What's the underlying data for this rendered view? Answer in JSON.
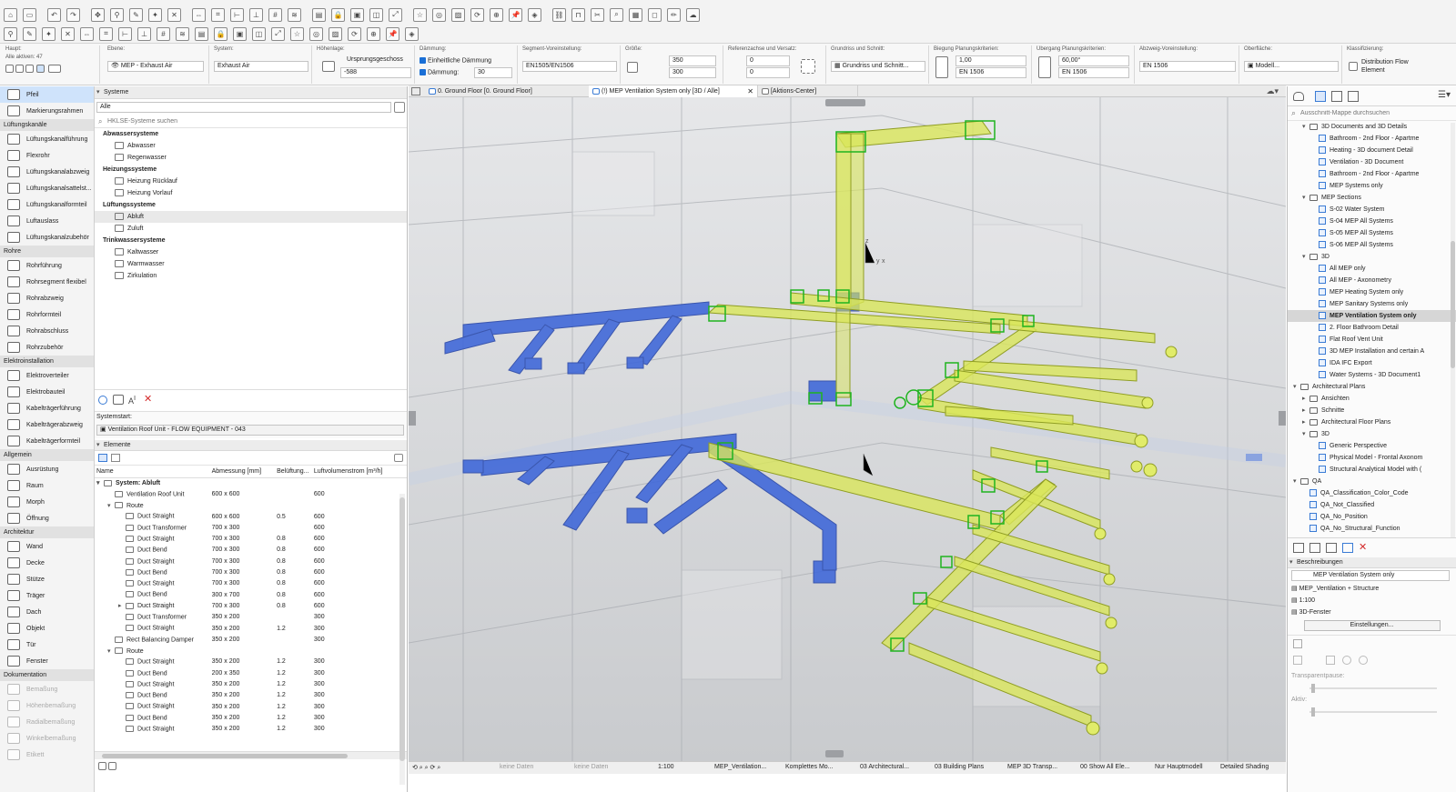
{
  "toolbar": {
    "row1_icons": [
      "home-icon",
      "save-icon",
      "undo-icon",
      "redo-icon",
      "pick-icon",
      "eyedropper-icon",
      "inject-icon",
      "magic-wand-icon",
      "cross-icon",
      "drag-icon",
      "snap-icon",
      "guide-icon",
      "gravity-icon",
      "grid-icon",
      "trace-icon",
      "layer-icon",
      "lock-icon",
      "group-icon",
      "suspend-icon",
      "transform-icon",
      "favorites-icon",
      "renovation-icon",
      "image-icon",
      "rotate-icon",
      "zoom-icon",
      "pin-icon",
      "fill-icon",
      "link-icon",
      "fence-icon",
      "cut-icon",
      "search-icon",
      "table-icon",
      "cube-icon",
      "brush-icon",
      "cloud-icon"
    ],
    "row2_icons": [
      "select-icon",
      "fill-pick-icon",
      "percent-icon",
      "layers-icon",
      "trace1-icon",
      "trace2-icon",
      "trace3-icon",
      "render-icon",
      "zoom-in-icon",
      "zoom-out-icon",
      "teamwork-icon",
      "orbit-icon",
      "view-icon",
      "camera-icon",
      "walk-icon",
      "window-icon",
      "grid2-icon",
      "sun-icon",
      "shadow-icon",
      "align-icon",
      "measure-icon",
      "marker-icon"
    ]
  },
  "infobox": {
    "haupt_label": "Haupt:",
    "alle_aktiv": "Alle aktiven: 47",
    "ebene_label": "Ebene:",
    "ebene_value": "MEP - Exhaust Air",
    "system_label": "System:",
    "system_value": "Exhaust Air",
    "hoehenlage_label": "Höhenlage:",
    "hoehenlage_value": "Ursprungsgeschoss",
    "hoehenlage_num": "-588",
    "daemmung_label": "Dämmung:",
    "einheitliche": "Einheitliche Dämmung",
    "daemmung_field": "Dämmung:",
    "daemmung_value": "30",
    "segment_label": "Segment-Voreinstellung:",
    "segment_value": "EN1505/EN1506",
    "groesse_label": "Größe:",
    "groesse_w": "350",
    "groesse_h": "300",
    "referenz_label": "Referenzachse und Versatz:",
    "ref_x": "0",
    "ref_y": "0",
    "grundriss_label": "Grundriss und Schnitt:",
    "grundriss_value": "Grundriss und Schnitt...",
    "biegung_label": "Biegung Planungskriterien:",
    "biegung_value": "1,00",
    "biegung_norm": "EN 1506",
    "uebergang_label": "Übergang Planungskriterien:",
    "uebergang_value": "60,00°",
    "uebergang_norm": "EN 1506",
    "abzweig_label": "Abzweig-Voreinstellung:",
    "abzweig_value": "EN 1506",
    "oberflaeche_label": "Oberfläche:",
    "oberflaeche_value": "Modell...",
    "klassifizierung_label": "Klassifizierung:",
    "klassifizierung_value1": "Distribution Flow",
    "klassifizierung_value2": "Element"
  },
  "toolbox": {
    "items": [
      {
        "type": "tool",
        "label": "Pfeil",
        "selected": true,
        "icon": "arrow-icon"
      },
      {
        "type": "tool",
        "label": "Markierungsrahmen",
        "icon": "marquee-icon"
      },
      {
        "type": "group",
        "label": "Lüftungskanäle"
      },
      {
        "type": "tool",
        "label": "Lüftungskanalführung",
        "icon": "duct-routing-icon"
      },
      {
        "type": "tool",
        "label": "Flexrohr",
        "icon": "flex-duct-icon"
      },
      {
        "type": "tool",
        "label": "Lüftungskanalabzweig",
        "icon": "duct-branch-icon"
      },
      {
        "type": "tool",
        "label": "Lüftungskanalsattelst...",
        "icon": "duct-saddle-icon"
      },
      {
        "type": "tool",
        "label": "Lüftungskanalformteil",
        "icon": "duct-fitting-icon"
      },
      {
        "type": "tool",
        "label": "Luftauslass",
        "icon": "air-terminal-icon"
      },
      {
        "type": "tool",
        "label": "Lüftungskanalzubehör",
        "icon": "duct-accessory-icon"
      },
      {
        "type": "group",
        "label": "Rohre"
      },
      {
        "type": "tool",
        "label": "Rohrführung",
        "icon": "pipe-routing-icon"
      },
      {
        "type": "tool",
        "label": "Rohrsegment flexibel",
        "icon": "flex-pipe-icon"
      },
      {
        "type": "tool",
        "label": "Rohrabzweig",
        "icon": "pipe-branch-icon"
      },
      {
        "type": "tool",
        "label": "Rohrformteil",
        "icon": "pipe-fitting-icon"
      },
      {
        "type": "tool",
        "label": "Rohrabschluss",
        "icon": "pipe-end-icon"
      },
      {
        "type": "tool",
        "label": "Rohrzubehör",
        "icon": "pipe-accessory-icon"
      },
      {
        "type": "group",
        "label": "Elektroinstallation"
      },
      {
        "type": "tool",
        "label": "Elektroverteiler",
        "icon": "electrical-panel-icon"
      },
      {
        "type": "tool",
        "label": "Elektrobauteil",
        "icon": "electrical-part-icon"
      },
      {
        "type": "tool",
        "label": "Kabelträgerführung",
        "icon": "cable-tray-icon"
      },
      {
        "type": "tool",
        "label": "Kabelträgerabzweig",
        "icon": "cable-branch-icon"
      },
      {
        "type": "tool",
        "label": "Kabelträgerformteil",
        "icon": "cable-fitting-icon"
      },
      {
        "type": "group",
        "label": "Allgemein"
      },
      {
        "type": "tool",
        "label": "Ausrüstung",
        "icon": "equipment-icon"
      },
      {
        "type": "tool",
        "label": "Raum",
        "icon": "zone-icon"
      },
      {
        "type": "tool",
        "label": "Morph",
        "icon": "morph-icon"
      },
      {
        "type": "tool",
        "label": "Öffnung",
        "icon": "opening-icon"
      },
      {
        "type": "group",
        "label": "Architektur"
      },
      {
        "type": "tool",
        "label": "Wand",
        "icon": "wall-icon"
      },
      {
        "type": "tool",
        "label": "Decke",
        "icon": "slab-icon"
      },
      {
        "type": "tool",
        "label": "Stütze",
        "icon": "column-icon"
      },
      {
        "type": "tool",
        "label": "Träger",
        "icon": "beam-icon"
      },
      {
        "type": "tool",
        "label": "Dach",
        "icon": "roof-icon"
      },
      {
        "type": "tool",
        "label": "Objekt",
        "icon": "object-icon"
      },
      {
        "type": "tool",
        "label": "Tür",
        "icon": "door-icon"
      },
      {
        "type": "tool",
        "label": "Fenster",
        "icon": "window-icon"
      },
      {
        "type": "group",
        "label": "Dokumentation"
      },
      {
        "type": "tool",
        "label": "Bemaßung",
        "dim": true,
        "icon": "dimension-icon"
      },
      {
        "type": "tool",
        "label": "Höhenbemaßung",
        "dim": true,
        "icon": "level-dimension-icon"
      },
      {
        "type": "tool",
        "label": "Radialbemaßung",
        "dim": true,
        "icon": "radial-dimension-icon"
      },
      {
        "type": "tool",
        "label": "Winkelbemaßung",
        "dim": true,
        "icon": "angle-dimension-icon"
      },
      {
        "type": "tool",
        "label": "Etikett",
        "dim": true,
        "icon": "label-icon"
      }
    ]
  },
  "navigator": {
    "header": "Systeme",
    "filter_value": "Alle",
    "search_placeholder": "HKLSE-Systeme suchen",
    "tree": [
      {
        "type": "b",
        "label": "Abwassersysteme"
      },
      {
        "type": "c",
        "label": "Abwasser"
      },
      {
        "type": "c",
        "label": "Regenwasser"
      },
      {
        "type": "b",
        "label": "Heizungssysteme"
      },
      {
        "type": "c",
        "label": "Heizung Rücklauf"
      },
      {
        "type": "c",
        "label": "Heizung Vorlauf"
      },
      {
        "type": "b",
        "label": "Lüftungssysteme"
      },
      {
        "type": "c",
        "label": "Abluft",
        "hl": true
      },
      {
        "type": "c",
        "label": "Zuluft"
      },
      {
        "type": "b",
        "label": "Trinkwassersysteme"
      },
      {
        "type": "c",
        "label": "Kaltwasser"
      },
      {
        "type": "c",
        "label": "Warmwasser"
      },
      {
        "type": "c",
        "label": "Zirkulation"
      }
    ],
    "systemstart_label": "Systemstart:",
    "systemstart_value": "Ventilation Roof Unit - FLOW EQUIPMENT - 043",
    "elements_header": "Elemente",
    "columns": [
      "Name",
      "Abmessung [mm]",
      "Belüftung...",
      "Luftvolumenstrom [m³/h]"
    ],
    "rows": [
      {
        "indent": 0,
        "bold": true,
        "name": "System: Abluft",
        "dim": "",
        "bel": "",
        "flow": "",
        "tw": "v"
      },
      {
        "indent": 1,
        "name": "Ventilation Roof Unit",
        "dim": "600 x 600",
        "bel": "",
        "flow": "600"
      },
      {
        "indent": 1,
        "name": "Route",
        "dim": "",
        "bel": "",
        "flow": "",
        "tw": "v"
      },
      {
        "indent": 2,
        "name": "Duct Straight",
        "dim": "600 x 600",
        "bel": "0.5",
        "flow": "600"
      },
      {
        "indent": 2,
        "name": "Duct Transformer",
        "dim": "700 x 300",
        "bel": "",
        "flow": "600"
      },
      {
        "indent": 2,
        "name": "Duct Straight",
        "dim": "700 x 300",
        "bel": "0.8",
        "flow": "600"
      },
      {
        "indent": 2,
        "name": "Duct Bend",
        "dim": "700 x 300",
        "bel": "0.8",
        "flow": "600"
      },
      {
        "indent": 2,
        "name": "Duct Straight",
        "dim": "700 x 300",
        "bel": "0.8",
        "flow": "600"
      },
      {
        "indent": 2,
        "name": "Duct Bend",
        "dim": "700 x 300",
        "bel": "0.8",
        "flow": "600"
      },
      {
        "indent": 2,
        "name": "Duct Straight",
        "dim": "700 x 300",
        "bel": "0.8",
        "flow": "600"
      },
      {
        "indent": 2,
        "name": "Duct Bend",
        "dim": "300 x 700",
        "bel": "0.8",
        "flow": "600"
      },
      {
        "indent": 2,
        "name": "Duct Straight",
        "dim": "700 x 300",
        "bel": "0.8",
        "flow": "600",
        "tw": ">"
      },
      {
        "indent": 2,
        "name": "Duct Transformer",
        "dim": "350 x 200",
        "bel": "",
        "flow": "300"
      },
      {
        "indent": 2,
        "name": "Duct Straight",
        "dim": "350 x 200",
        "bel": "1.2",
        "flow": "300"
      },
      {
        "indent": 1,
        "name": "Rect Balancing Damper",
        "dim": "350 x 200",
        "bel": "",
        "flow": "300"
      },
      {
        "indent": 1,
        "name": "Route",
        "dim": "",
        "bel": "",
        "flow": "",
        "tw": "v"
      },
      {
        "indent": 2,
        "name": "Duct Straight",
        "dim": "350 x 200",
        "bel": "1.2",
        "flow": "300"
      },
      {
        "indent": 2,
        "name": "Duct Bend",
        "dim": "200 x 350",
        "bel": "1.2",
        "flow": "300"
      },
      {
        "indent": 2,
        "name": "Duct Straight",
        "dim": "350 x 200",
        "bel": "1.2",
        "flow": "300"
      },
      {
        "indent": 2,
        "name": "Duct Bend",
        "dim": "350 x 200",
        "bel": "1.2",
        "flow": "300"
      },
      {
        "indent": 2,
        "name": "Duct Straight",
        "dim": "350 x 200",
        "bel": "1.2",
        "flow": "300"
      },
      {
        "indent": 2,
        "name": "Duct Bend",
        "dim": "350 x 200",
        "bel": "1.2",
        "flow": "300"
      },
      {
        "indent": 2,
        "name": "Duct Straight",
        "dim": "350 x 200",
        "bel": "1.2",
        "flow": "300"
      }
    ]
  },
  "tabs": [
    {
      "label": "0. Ground Floor [0. Ground Floor]"
    },
    {
      "label": "(!) MEP Ventilation System only [3D / Alle]",
      "active": true
    },
    {
      "label": "[Aktions-Center]"
    }
  ],
  "viewport": {
    "axis_z": "z",
    "axis_y": "y",
    "axis_x": "x",
    "colors": {
      "duct": "#d9e65a",
      "duct_edge": "#9aa92a",
      "connector": "#2fbf2f",
      "blue": "#3f63d8",
      "bg": "#d7d9dc"
    }
  },
  "status": {
    "items": [
      "keine Daten",
      "keine Daten",
      "1:100",
      "MEP_Ventilation...",
      "Komplettes Mo...",
      "03 Architectural...",
      "03 Building Plans",
      "MEP 3D Transp...",
      "00 Show All Ele...",
      "Nur Hauptmodell",
      "Detailed Shading"
    ]
  },
  "rightpanel": {
    "search_placeholder": "Ausschnitt-Mappe durchsuchen",
    "tree": [
      {
        "lvl": 1,
        "tw": "v",
        "kind": "folder",
        "label": "3D Documents and 3D Details"
      },
      {
        "lvl": 2,
        "kind": "view",
        "label": "Bathroom - 2nd Floor - Apartme"
      },
      {
        "lvl": 2,
        "kind": "view",
        "label": "Heating - 3D document Detail"
      },
      {
        "lvl": 2,
        "kind": "view",
        "label": "Ventilation - 3D Document"
      },
      {
        "lvl": 2,
        "kind": "view",
        "label": "Bathroom - 2nd Floor - Apartme"
      },
      {
        "lvl": 2,
        "kind": "view",
        "label": "MEP Systems only"
      },
      {
        "lvl": 1,
        "tw": "v",
        "kind": "folder",
        "label": "MEP Sections"
      },
      {
        "lvl": 2,
        "kind": "view",
        "label": "S-02 Water System"
      },
      {
        "lvl": 2,
        "kind": "view",
        "label": "S-04 MEP All Systems"
      },
      {
        "lvl": 2,
        "kind": "view",
        "label": "S-05 MEP All Systems"
      },
      {
        "lvl": 2,
        "kind": "view",
        "label": "S-06 MEP All Systems"
      },
      {
        "lvl": 1,
        "tw": "v",
        "kind": "folder",
        "label": "3D"
      },
      {
        "lvl": 2,
        "kind": "view",
        "label": "All MEP only"
      },
      {
        "lvl": 2,
        "kind": "view",
        "label": "All MEP - Axonometry"
      },
      {
        "lvl": 2,
        "kind": "view",
        "label": "MEP Heating System only"
      },
      {
        "lvl": 2,
        "kind": "view",
        "label": "MEP Sanitary Systems only"
      },
      {
        "lvl": 2,
        "kind": "view",
        "label": "MEP Ventilation System only",
        "sel": true
      },
      {
        "lvl": 2,
        "kind": "view",
        "label": "2. Floor Bathroom Detail"
      },
      {
        "lvl": 2,
        "kind": "view",
        "label": "Flat Roof Vent Unit"
      },
      {
        "lvl": 2,
        "kind": "view",
        "label": "3D MEP Installation and certain A"
      },
      {
        "lvl": 2,
        "kind": "view",
        "label": "IDA IFC Export"
      },
      {
        "lvl": 2,
        "kind": "view",
        "label": "Water Systems - 3D Document1"
      },
      {
        "lvl": 0,
        "tw": "v",
        "kind": "folder",
        "label": "Architectural Plans"
      },
      {
        "lvl": 1,
        "tw": ">",
        "kind": "folder",
        "label": "Ansichten"
      },
      {
        "lvl": 1,
        "tw": ">",
        "kind": "folder",
        "label": "Schnitte"
      },
      {
        "lvl": 1,
        "tw": ">",
        "kind": "folder",
        "label": "Architectural Floor Plans"
      },
      {
        "lvl": 1,
        "tw": "v",
        "kind": "folder",
        "label": "3D"
      },
      {
        "lvl": 2,
        "kind": "view",
        "label": "Generic Perspective"
      },
      {
        "lvl": 2,
        "kind": "view",
        "label": "Physical Model - Frontal Axonom"
      },
      {
        "lvl": 2,
        "kind": "view",
        "label": "Structural Analytical Model with ("
      },
      {
        "lvl": 0,
        "tw": "v",
        "kind": "folder",
        "label": "QA"
      },
      {
        "lvl": 1,
        "kind": "view",
        "label": "QA_Classification_Color_Code"
      },
      {
        "lvl": 1,
        "kind": "view",
        "label": "QA_Not_Classified"
      },
      {
        "lvl": 1,
        "kind": "view",
        "label": "QA_No_Position"
      },
      {
        "lvl": 1,
        "kind": "view",
        "label": "QA_No_Structural_Function"
      }
    ],
    "beschreibungen": "Beschreibungen",
    "view_name": "MEP Ventilation System only",
    "view_path": "MEP_Ventilation + Structure",
    "scale": "1:100",
    "fenster": "3D-Fenster",
    "einstellungen": "Einstellungen...",
    "transparenz": "Transparentpause:",
    "aktiv": "Aktiv:"
  }
}
